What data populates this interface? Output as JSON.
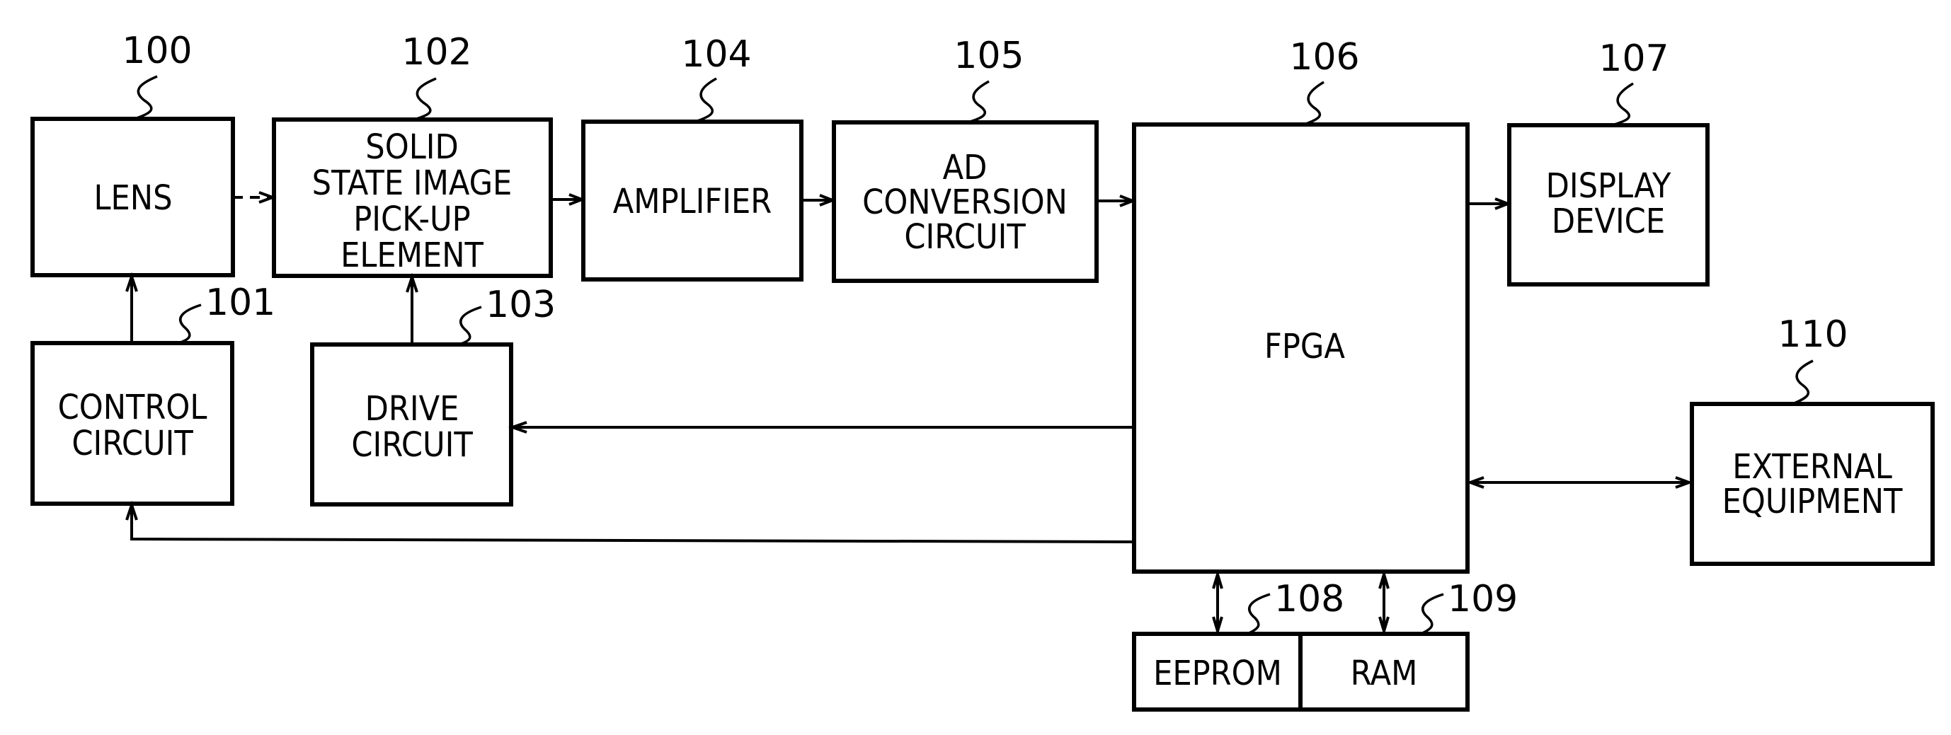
{
  "diagram": {
    "type": "block-diagram",
    "blocks": [
      {
        "id": "lens",
        "ref": "100",
        "lines": [
          "LENS"
        ]
      },
      {
        "id": "control",
        "ref": "101",
        "lines": [
          "CONTROL",
          "CIRCUIT"
        ]
      },
      {
        "id": "sensor",
        "ref": "102",
        "lines": [
          "SOLID",
          "STATE IMAGE",
          "PICK-UP",
          "ELEMENT"
        ]
      },
      {
        "id": "drive",
        "ref": "103",
        "lines": [
          "DRIVE",
          "CIRCUIT"
        ]
      },
      {
        "id": "amp",
        "ref": "104",
        "lines": [
          "AMPLIFIER"
        ]
      },
      {
        "id": "adc",
        "ref": "105",
        "lines": [
          "AD",
          "CONVERSION",
          "CIRCUIT"
        ]
      },
      {
        "id": "fpga",
        "ref": "106",
        "lines": [
          "FPGA"
        ]
      },
      {
        "id": "display",
        "ref": "107",
        "lines": [
          "DISPLAY",
          "DEVICE"
        ]
      },
      {
        "id": "eeprom",
        "ref": "108",
        "lines": [
          "EEPROM"
        ]
      },
      {
        "id": "ram",
        "ref": "109",
        "lines": [
          "RAM"
        ]
      },
      {
        "id": "external",
        "ref": "110",
        "lines": [
          "EXTERNAL",
          "EQUIPMENT"
        ]
      }
    ],
    "connections": [
      {
        "from": "lens",
        "to": "sensor",
        "style": "dashed",
        "direction": "forward"
      },
      {
        "from": "sensor",
        "to": "amp",
        "direction": "forward"
      },
      {
        "from": "amp",
        "to": "adc",
        "direction": "forward"
      },
      {
        "from": "adc",
        "to": "fpga",
        "direction": "forward"
      },
      {
        "from": "fpga",
        "to": "display",
        "direction": "forward"
      },
      {
        "from": "control",
        "to": "lens",
        "direction": "forward"
      },
      {
        "from": "drive",
        "to": "sensor",
        "direction": "forward"
      },
      {
        "from": "fpga",
        "to": "drive",
        "direction": "forward"
      },
      {
        "from": "fpga",
        "to": "control",
        "direction": "forward"
      },
      {
        "from": "fpga",
        "to": "external",
        "direction": "bidirectional"
      },
      {
        "from": "fpga",
        "to": "eeprom",
        "direction": "bidirectional"
      },
      {
        "from": "fpga",
        "to": "ram",
        "direction": "bidirectional"
      }
    ]
  }
}
